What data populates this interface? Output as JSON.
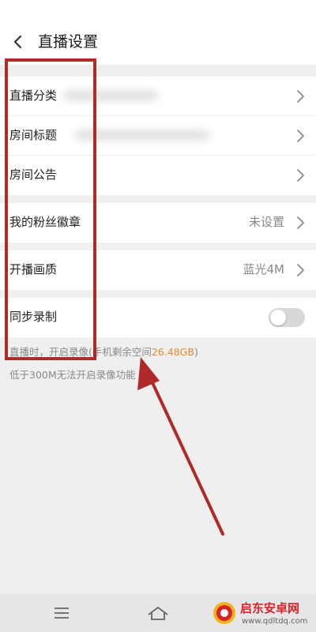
{
  "header": {
    "title": "直播设置",
    "back_icon": "back-arrow-icon"
  },
  "settings": {
    "category_label": "直播分类",
    "room_title_label": "房间标题",
    "announcement_label": "房间公告",
    "fan_badge_label": "我的粉丝徽章",
    "fan_badge_value": "未设置",
    "quality_label": "开播画质",
    "quality_value": "蓝光4M",
    "sync_record_label": "同步录制",
    "sync_record_enabled": false
  },
  "hint": {
    "line1_prefix": "直播时，开启录像(手机剩余空间",
    "line1_space": "26.48GB",
    "line1_suffix": ")",
    "line2": "低于300M无法开启录像功能"
  },
  "navbar": {
    "menu_icon": "menu-icon",
    "home_icon": "home-icon",
    "back_icon": "back-icon"
  },
  "watermark": {
    "title": "启东安卓网",
    "url": "www.qdltdq.com"
  },
  "colors": {
    "accent": "#e8892d",
    "annotation": "#b02a2a",
    "watermark": "#d8232a"
  }
}
